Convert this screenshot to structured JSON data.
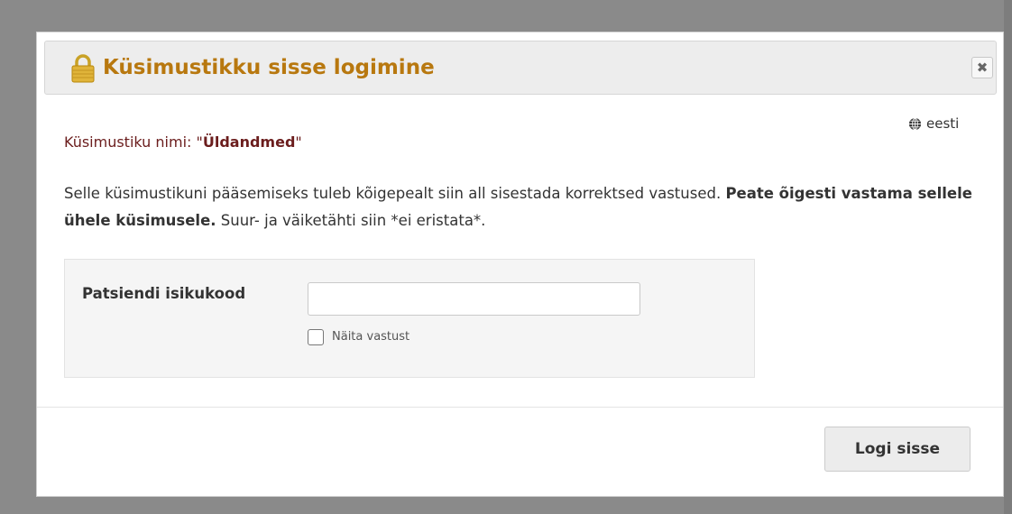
{
  "dialog": {
    "title": "Küsimustikku sisse logimine",
    "title_color": "#b8780f",
    "lock_icon": "padlock-icon",
    "close_label": "✖",
    "language": "eesti",
    "language_icon": "globe-icon",
    "questionnaire_label": "Küsimustiku nimi: \"",
    "questionnaire_name": "Üldandmed",
    "questionnaire_suffix": "\"",
    "questionnaire_color": "#6b1d1d",
    "intro_text": "Selle küsimustikuni pääsemiseks tuleb kõigepealt siin all sisestada korrektsed vastused. ",
    "intro_bold": "Peate õigesti vastama sellele ühele küsimusele.",
    "intro_tail": " Suur- ja väiketähti siin *ei eristata*.",
    "field_label": "Patsiendi isikukood",
    "field_value": "",
    "show_answer_label": "Näita vastust",
    "show_answer_checked": false,
    "login_label": "Logi sisse"
  }
}
